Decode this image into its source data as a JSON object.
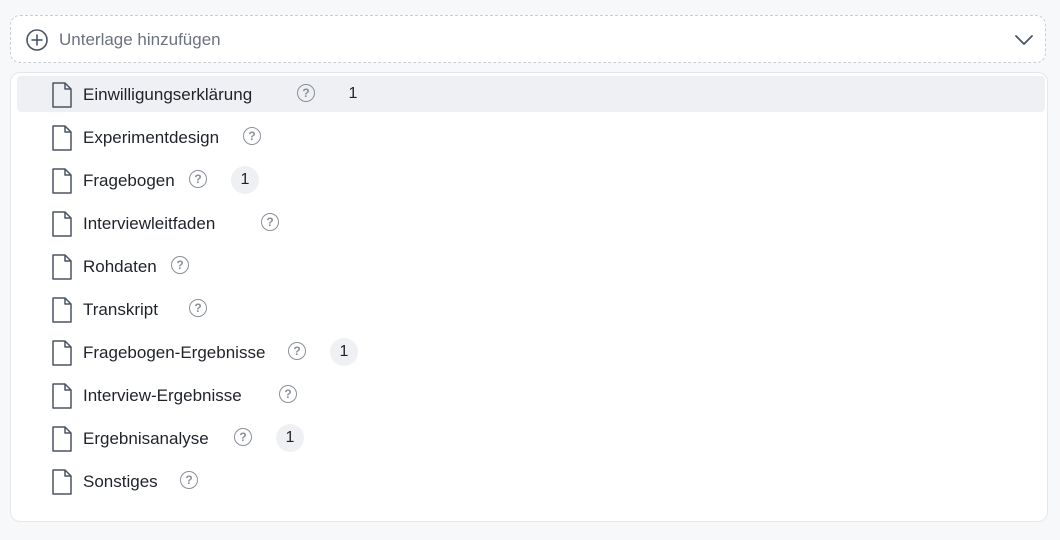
{
  "add_bar": {
    "label": "Unterlage hinzufügen",
    "plus_icon": "plus-circle-icon",
    "chevron_icon": "chevron-down-icon"
  },
  "help_glyph": "?",
  "items": [
    {
      "name": "Einwilligungserklärung",
      "count": "1"
    },
    {
      "name": "Experimentdesign",
      "count": ""
    },
    {
      "name": "Fragebogen",
      "count": "1"
    },
    {
      "name": "Interviewleitfaden",
      "count": ""
    },
    {
      "name": "Rohdaten",
      "count": ""
    },
    {
      "name": "Transkript",
      "count": ""
    },
    {
      "name": "Fragebogen-Ergebnisse",
      "count": "1"
    },
    {
      "name": "Interview-Ergebnisse",
      "count": ""
    },
    {
      "name": "Ergebnisanalyse",
      "count": "1"
    },
    {
      "name": "Sonstiges",
      "count": ""
    }
  ]
}
